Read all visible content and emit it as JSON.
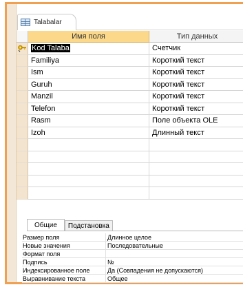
{
  "tab": {
    "title": "Talabalar",
    "icon": "table-icon"
  },
  "grid": {
    "headers": {
      "field_name": "Имя поля",
      "data_type": "Тип данных"
    },
    "rows": [
      {
        "name": "Kod Talaba",
        "type": "Счетчик",
        "primary_key": true,
        "selected": true
      },
      {
        "name": "Familiya",
        "type": "Короткий текст"
      },
      {
        "name": "Ism",
        "type": "Короткий текст"
      },
      {
        "name": "Guruh",
        "type": "Короткий текст"
      },
      {
        "name": "Manzil",
        "type": "Короткий текст"
      },
      {
        "name": "Telefon",
        "type": "Короткий текст"
      },
      {
        "name": "Rasm",
        "type": "Поле объекта OLE"
      },
      {
        "name": "Izoh",
        "type": "Длинный текст"
      }
    ]
  },
  "properties": {
    "tabs": [
      "Общие",
      "Подстановка"
    ],
    "rows": [
      {
        "label": "Размер поля",
        "value": "Длинное целое"
      },
      {
        "label": "Новые значения",
        "value": "Последовательные"
      },
      {
        "label": "Формат поля",
        "value": ""
      },
      {
        "label": "Подпись",
        "value": "№"
      },
      {
        "label": "Индексированное поле",
        "value": "Да (Совпадения не допускаются)"
      },
      {
        "label": "Выравнивание текста",
        "value": "Общее"
      }
    ]
  },
  "colors": {
    "frame": "#f0a050",
    "header_active": "#fbd88a",
    "selector": "#f3e4d0"
  }
}
